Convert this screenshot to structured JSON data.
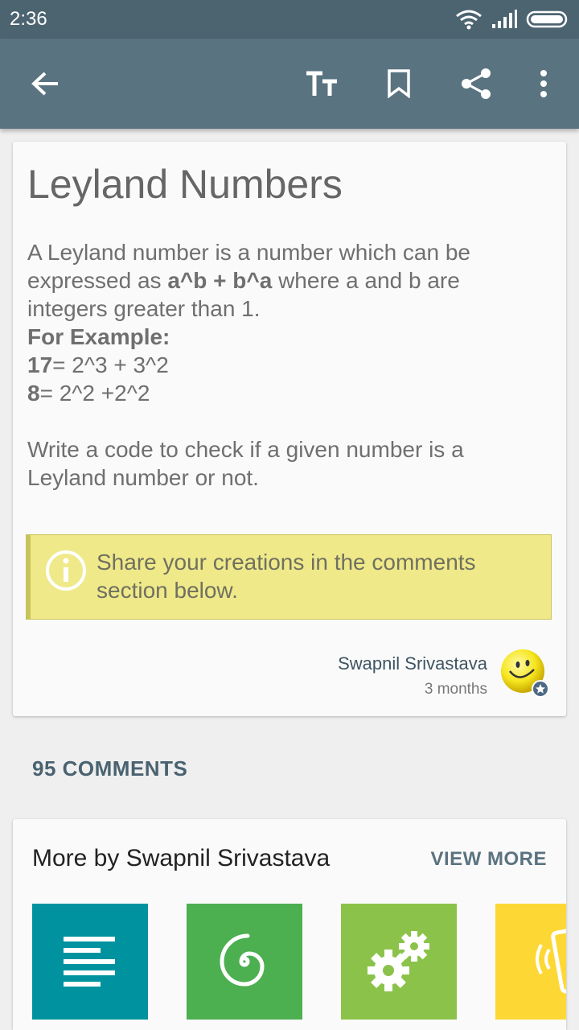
{
  "status": {
    "time": "2:36"
  },
  "article": {
    "title": "Leyland Numbers",
    "intro": "A Leyland number is a number which can be expressed as ",
    "formula": "a^b + b^a",
    "intro_end": " where a and b are integers greater than 1.",
    "example_heading": "For Example:",
    "example1_bold": "17",
    "example1_rest": "= 2^3 + 3^2",
    "example2_bold": "8",
    "example2_rest": "= 2^2 +2^2",
    "task": "Write a code to check if a given number is a Leyland number or not.",
    "tip": "Share your creations in the comments section below.",
    "author": "Swapnil Srivastava",
    "time": "3 months"
  },
  "comments_count": "95 COMMENTS",
  "more": {
    "title": "More by Swapnil Srivastava",
    "view_more": "VIEW MORE"
  },
  "colors": {
    "tile1": "#00939f",
    "tile2": "#4caf50",
    "tile3": "#8bc34a",
    "tile4": "#fdd835"
  }
}
